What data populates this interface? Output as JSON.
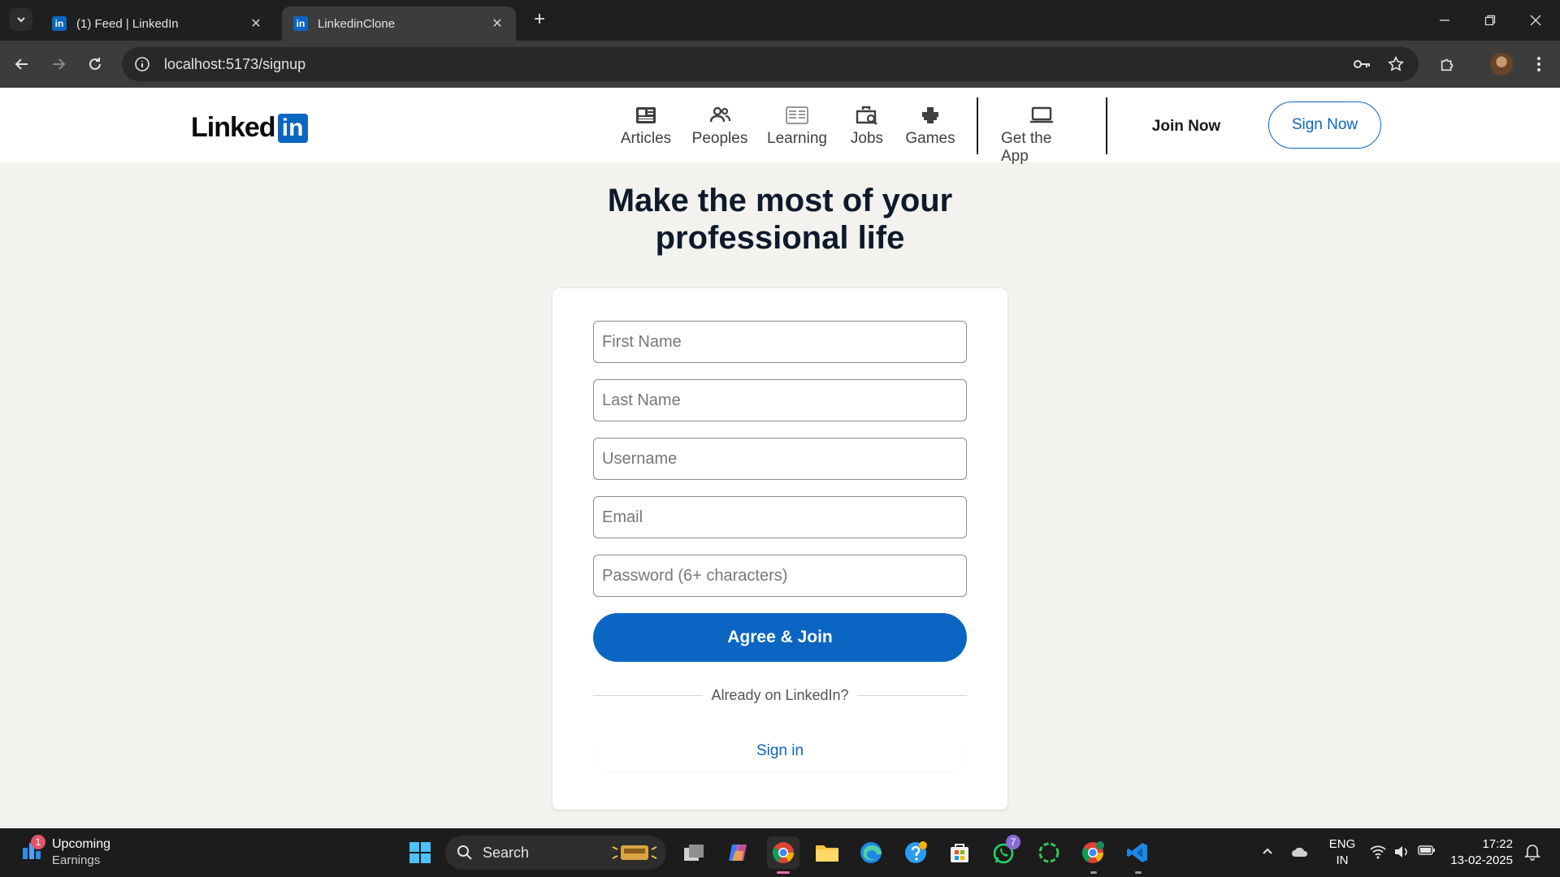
{
  "browser": {
    "tabs": [
      {
        "title": "(1) Feed | LinkedIn",
        "favicon": "in"
      },
      {
        "title": "LinkedinClone",
        "favicon": "in"
      }
    ],
    "url": "localhost:5173/signup"
  },
  "header": {
    "logo_text": "Linked",
    "logo_badge": "in",
    "nav": [
      {
        "label": "Articles",
        "icon": "articles-icon"
      },
      {
        "label": "Peoples",
        "icon": "people-icon"
      },
      {
        "label": "Learning",
        "icon": "learning-icon"
      },
      {
        "label": "Jobs",
        "icon": "jobs-icon"
      },
      {
        "label": "Games",
        "icon": "games-icon"
      },
      {
        "label": "Get the App",
        "icon": "laptop-icon"
      }
    ],
    "join_now": "Join Now",
    "sign_now": "Sign Now"
  },
  "main": {
    "headline_line1": "Make the most of your",
    "headline_line2": "professional life",
    "form": {
      "first_name_placeholder": "First Name",
      "last_name_placeholder": "Last Name",
      "username_placeholder": "Username",
      "email_placeholder": "Email",
      "password_placeholder": "Password (6+ characters)",
      "submit_label": "Agree & Join",
      "divider_text": "Already on LinkedIn?",
      "signin_label": "Sign in"
    }
  },
  "taskbar": {
    "widget_title": "Upcoming",
    "widget_subtitle": "Earnings",
    "widget_badge": "1",
    "search_label": "Search",
    "whatsapp_badge": "7",
    "lang_line1": "ENG",
    "lang_line2": "IN",
    "time": "17:22",
    "date": "13-02-2025"
  },
  "colors": {
    "brand": "#0a66c2",
    "page_bg": "#f3f2ef",
    "headline": "#0e1a2b"
  }
}
